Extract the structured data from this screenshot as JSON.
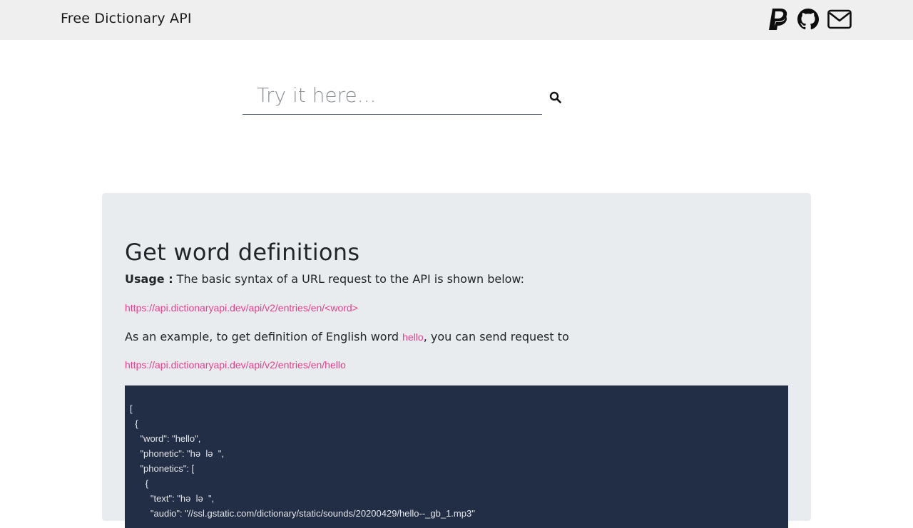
{
  "navbar": {
    "brand": "Free Dictionary API",
    "icons": [
      "paypal-icon",
      "github-icon",
      "envelope-icon"
    ]
  },
  "search": {
    "placeholder": "Try it here...",
    "value": "",
    "icon": "search-icon"
  },
  "section": {
    "title": "Get word definitions",
    "usage_label": "Usage :",
    "usage_text": " The basic syntax of a URL request to the API is shown below:",
    "syntax_url": "https://api.dictionaryapi.dev/api/v2/entries/en/<word>",
    "example_before": "As an example, to get definition of English word ",
    "example_word": "hello",
    "example_after": ", you can send request to",
    "example_url": "https://api.dictionaryapi.dev/api/v2/entries/en/hello"
  },
  "code_sample": "[\n  {\n    \"word\": \"hello\",\n    \"phonetic\": \"hə  lə  \",\n    \"phonetics\": [\n      {\n        \"text\": \"hə  lə  \",\n        \"audio\": \"//ssl.gstatic.com/dictionary/static/sounds/20200429/hello--_gb_1.mp3\""
}
